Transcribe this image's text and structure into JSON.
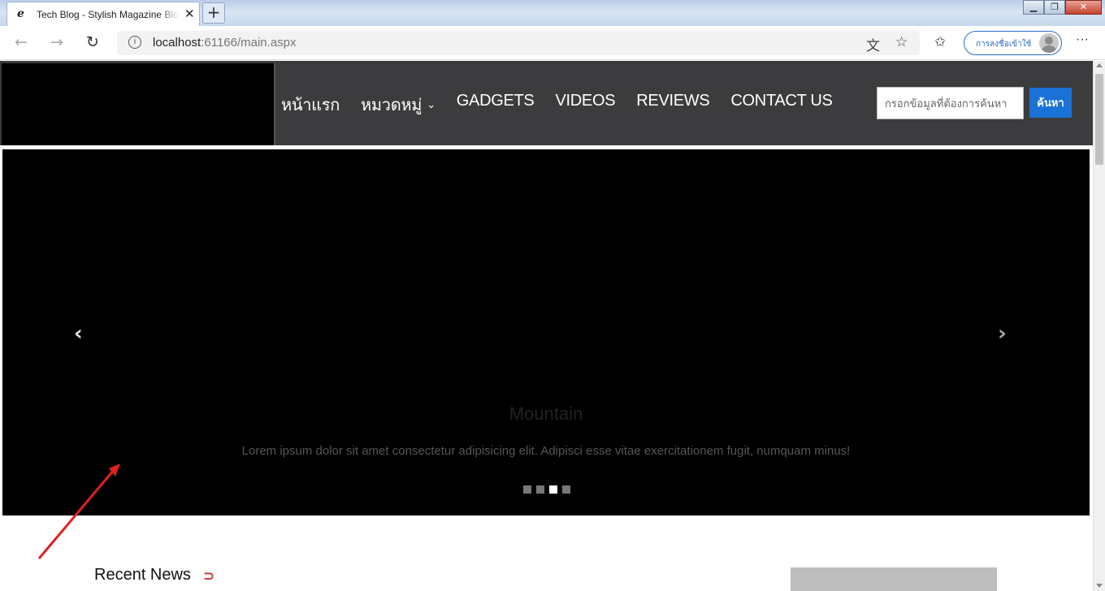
{
  "browser": {
    "tab_icon": "e",
    "tab_title": "Tech Blog - Stylish Magazine Blog",
    "tab_close": "✕",
    "new_tab": "+",
    "url_host": "localhost",
    "url_rest": ":61166/main.aspx",
    "signin_label": "การลงชื่อเข้าใช้",
    "more_label": "···",
    "icons": [
      "back-icon",
      "forward-icon",
      "refresh-icon",
      "info-icon",
      "translate-icon",
      "favorite-star-icon",
      "favorites-list-icon",
      "profile-avatar-icon"
    ]
  },
  "header": {
    "menu": [
      {
        "label": "หน้าแรก"
      },
      {
        "label": "หมวดหมู่",
        "dropdown": "⌄"
      },
      {
        "label": "GADGETS"
      },
      {
        "label": "VIDEOS"
      },
      {
        "label": "REVIEWS"
      },
      {
        "label": "CONTACT US"
      }
    ],
    "search_placeholder": "กรอกข้อมูลที่ต้องการค้นหา",
    "search_button": "ค้นหา"
  },
  "carousel": {
    "prev": "‹",
    "next": "›",
    "title": "Mountain",
    "caption": "Lorem ipsum dolor sit amet consectetur adipisicing elit. Adipisci esse vitae exercitationem fugit, numquam minus!",
    "slide_count": 4,
    "active_index": 2
  },
  "content": {
    "recent_news": "Recent News",
    "rss_icon": "rss-icon"
  },
  "colors": {
    "header_bg": "#3c3c3e",
    "search_button": "#1a72d6",
    "annotation_arrow": "#e02020"
  }
}
